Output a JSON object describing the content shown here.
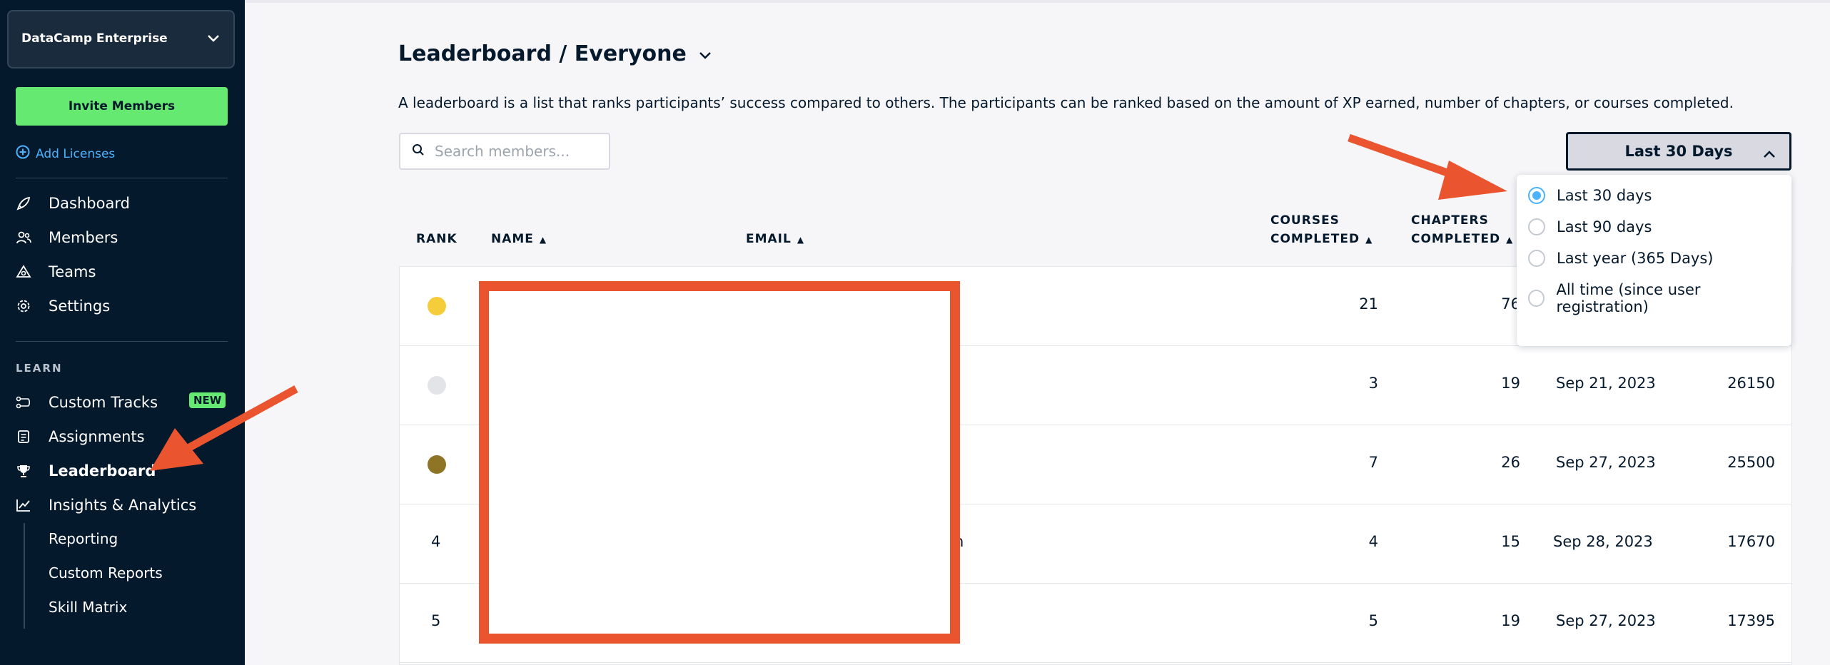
{
  "sidebar": {
    "org_name": "DataCamp Enterprise",
    "invite_label": "Invite Members",
    "add_licenses_label": "Add Licenses",
    "nav": [
      {
        "label": "Dashboard",
        "icon": "rocket-icon"
      },
      {
        "label": "Members",
        "icon": "members-icon"
      },
      {
        "label": "Teams",
        "icon": "teams-icon"
      },
      {
        "label": "Settings",
        "icon": "gear-icon"
      }
    ],
    "section_learn": "LEARN",
    "learn": [
      {
        "label": "Custom Tracks",
        "icon": "tracks-icon",
        "badge": "NEW"
      },
      {
        "label": "Assignments",
        "icon": "assignments-icon"
      },
      {
        "label": "Leaderboard",
        "icon": "trophy-icon",
        "active": true
      },
      {
        "label": "Insights & Analytics",
        "icon": "chart-icon"
      }
    ],
    "insights_sub": [
      "Reporting",
      "Custom Reports",
      "Skill Matrix"
    ]
  },
  "main": {
    "title": "Leaderboard / Everyone",
    "description": "A leaderboard is a list that ranks participants’ success compared to others. The participants can be ranked based on the amount of XP earned, number of chapters, or courses completed.",
    "search_placeholder": "Search members...",
    "period_selected": "Last 30 Days",
    "period_options": [
      {
        "label": "Last 30 days",
        "selected": true
      },
      {
        "label": "Last 90 days",
        "selected": false
      },
      {
        "label": "Last year (365 Days)",
        "selected": false
      },
      {
        "label": "All time (since user registration)",
        "selected": false
      }
    ],
    "columns": {
      "rank": "RANK",
      "name": "NAME",
      "email": "EMAIL",
      "courses_1": "COURSES",
      "courses_2": "COMPLETED",
      "chapters_1": "CHAPTERS",
      "chapters_2": "COMPLETED"
    },
    "rows": [
      {
        "rank": "",
        "medal": "#f5cc3a",
        "courses": "21",
        "chapters": "76",
        "date": "",
        "xp": ""
      },
      {
        "rank": "",
        "medal": "#e3e4e8",
        "courses": "3",
        "chapters": "19",
        "date": "Sep 21, 2023",
        "xp": "26150"
      },
      {
        "rank": "",
        "medal": "#8e7425",
        "courses": "7",
        "chapters": "26",
        "date": "Sep 27, 2023",
        "xp": "25500"
      },
      {
        "rank": "4",
        "medal": "",
        "courses": "4",
        "chapters": "15",
        "date": "Sep 28, 2023",
        "xp": "17670",
        "email_tail": "n"
      },
      {
        "rank": "5",
        "medal": "",
        "courses": "5",
        "chapters": "19",
        "date": "Sep 27, 2023",
        "xp": "17395"
      }
    ]
  },
  "colors": {
    "sidebar_bg": "#05192d",
    "accent_green": "#65e971",
    "link_blue": "#4bb3fd",
    "annotation_red": "#ea5530"
  }
}
